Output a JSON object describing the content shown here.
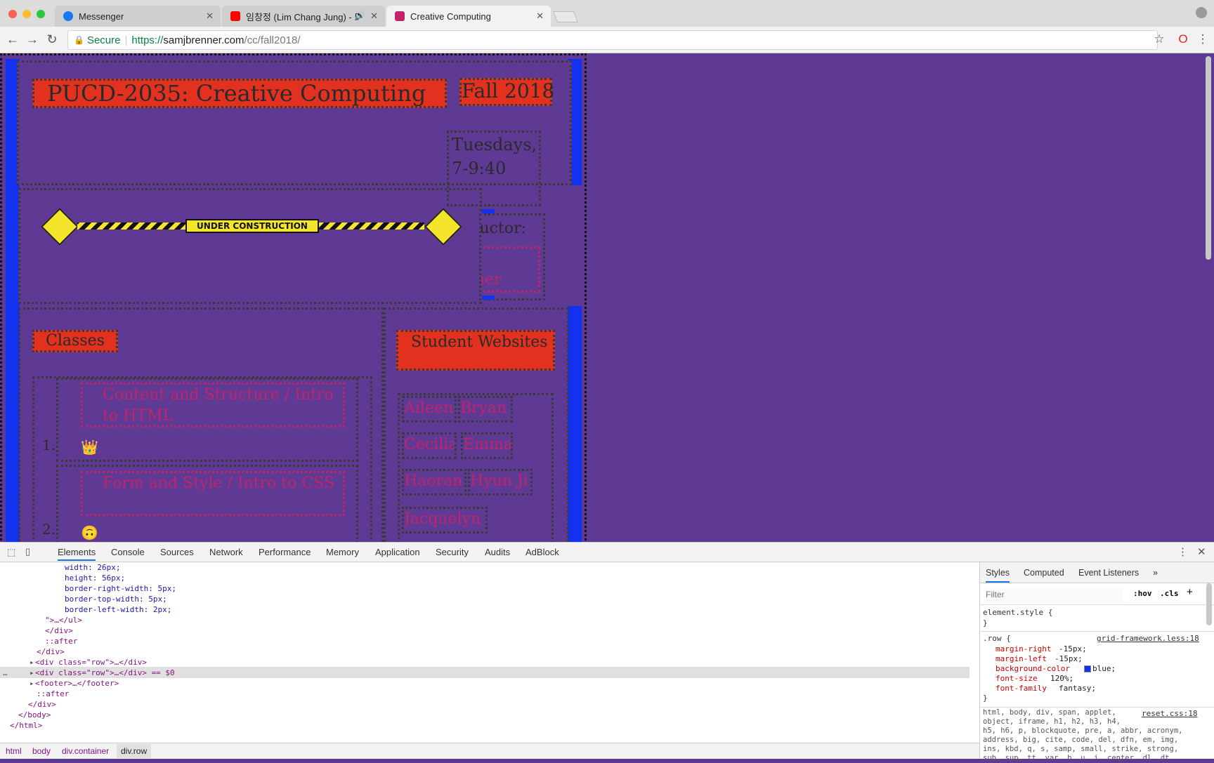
{
  "browser": {
    "tabs": [
      {
        "title": "Messenger",
        "icon": "messenger-icon",
        "color": "#1877f2"
      },
      {
        "title": "임창정 (Lim Chang Jung) - 또",
        "icon": "youtube-icon",
        "color": "#ff0000"
      },
      {
        "title": "Creative Computing",
        "icon": "page-favicon",
        "color": "#c0246b"
      }
    ],
    "secure_label": "Secure",
    "url_prefix": "https://",
    "url_host": "samjbrenner.com",
    "url_path": "/cc/fall2018/"
  },
  "page": {
    "course_title": "PUCD-2035: Creative Computing",
    "semester": "Fall 2018",
    "schedule": "Tuesdays, 7-9:40",
    "instructor_label": "Instructor:",
    "instructor_name": "Sam Brenner",
    "construction_label": "UNDER CONSTRUCTION",
    "classes_heading": "Classes",
    "classes": [
      {
        "number": "1.",
        "title": "Content and Structure / Intro to HTML",
        "emoji": "👑"
      },
      {
        "number": "2.",
        "title": "Form and Style / Intro to CSS",
        "emoji": "🙃"
      }
    ],
    "students_heading": "Student Websites",
    "students": [
      "Aileen",
      "Bryan",
      "Cecilia",
      "Emma",
      "Haoran",
      "Hyun Ji",
      "Jacquelyn"
    ],
    "colors": {
      "background": "#5f3a95",
      "accent": "#e2311f",
      "bar": "#1232f0",
      "link": "#c0246b"
    }
  },
  "devtools": {
    "tabs": [
      "Elements",
      "Console",
      "Sources",
      "Network",
      "Performance",
      "Memory",
      "Application",
      "Security",
      "Audits",
      "AdBlock"
    ],
    "dom_lines": [
      "width: 26px;",
      "height: 56px;",
      "border-right-width: 5px;",
      "border-top-width: 5px;",
      "border-left-width: 2px;",
      "\">…</ul>",
      "</div>",
      "::after",
      "</div>",
      "<div class=\"row\">…</div>",
      "<div class=\"row\">…</div> == $0",
      "<footer>…</footer>",
      "::after",
      "</div>",
      "</body>",
      "</html>"
    ],
    "breadcrumbs": [
      "html",
      "body",
      "div.container",
      "div.row"
    ],
    "styles_tabs": [
      "Styles",
      "Computed",
      "Event Listeners"
    ],
    "filter_placeholder": "Filter",
    "hov_label": ":hov",
    "cls_label": ".cls",
    "element_style": "element.style {",
    "rule_selector": ".row {",
    "rule_source": "grid-framework.less:18",
    "rule_props": [
      {
        "name": "margin-right",
        "value": "-15px;"
      },
      {
        "name": "margin-left",
        "value": "-15px;"
      },
      {
        "name": "background-color",
        "value": "blue;"
      },
      {
        "name": "font-size",
        "value": "120%;"
      },
      {
        "name": "font-family",
        "value": "fantasy;"
      }
    ],
    "reset_source": "reset.css:18",
    "reset_selectors": "html, body, div, span, applet,\nobject, iframe, h1, h2, h3, h4,\nh5, h6, p, blockquote, pre, a, abbr, acronym,\naddress, big, cite, code, del, dfn, em, img,\nins, kbd, q, s, samp, small, strike, strong,\nsub, sup, tt, var, b, u, i, center, dl, dt,"
  }
}
